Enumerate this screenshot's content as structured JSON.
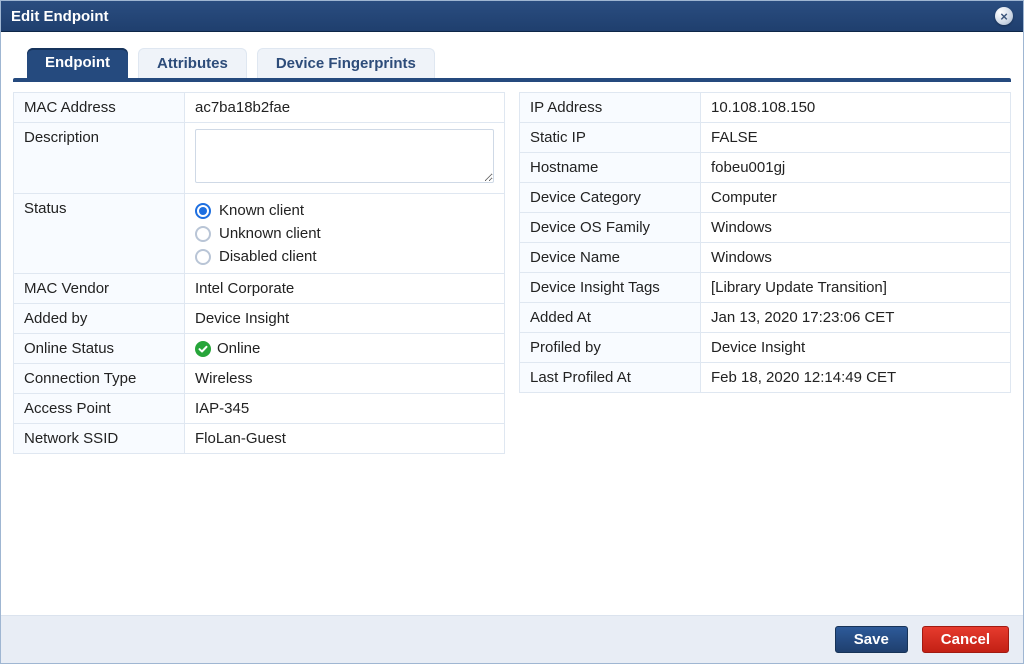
{
  "window": {
    "title": "Edit Endpoint",
    "close_icon": "×"
  },
  "tabs": [
    {
      "label": "Endpoint",
      "active": true
    },
    {
      "label": "Attributes",
      "active": false
    },
    {
      "label": "Device Fingerprints",
      "active": false
    }
  ],
  "left": {
    "mac_address": {
      "label": "MAC Address",
      "value": "ac7ba18b2fae"
    },
    "description": {
      "label": "Description",
      "value": ""
    },
    "status": {
      "label": "Status",
      "options": [
        {
          "label": "Known client",
          "checked": true
        },
        {
          "label": "Unknown client",
          "checked": false
        },
        {
          "label": "Disabled client",
          "checked": false
        }
      ]
    },
    "mac_vendor": {
      "label": "MAC Vendor",
      "value": "Intel Corporate"
    },
    "added_by": {
      "label": "Added by",
      "value": "Device Insight"
    },
    "online_status": {
      "label": "Online Status",
      "value": "Online",
      "icon": "check-circle"
    },
    "connection_type": {
      "label": "Connection Type",
      "value": "Wireless"
    },
    "access_point": {
      "label": "Access Point",
      "value": "IAP-345"
    },
    "network_ssid": {
      "label": "Network SSID",
      "value": "FloLan-Guest"
    }
  },
  "right": {
    "ip_address": {
      "label": "IP Address",
      "value": "10.108.108.150"
    },
    "static_ip": {
      "label": "Static IP",
      "value": "FALSE"
    },
    "hostname": {
      "label": "Hostname",
      "value": "fobeu001gj"
    },
    "device_category": {
      "label": "Device Category",
      "value": "Computer"
    },
    "device_os_family": {
      "label": "Device OS Family",
      "value": "Windows"
    },
    "device_name": {
      "label": "Device Name",
      "value": "Windows"
    },
    "device_insight_tags": {
      "label": "Device Insight Tags",
      "value": "[Library Update Transition]"
    },
    "added_at": {
      "label": "Added At",
      "value": "Jan 13, 2020 17:23:06 CET"
    },
    "profiled_by": {
      "label": "Profiled by",
      "value": "Device Insight"
    },
    "last_profiled_at": {
      "label": "Last Profiled At",
      "value": "Feb 18, 2020 12:14:49 CET"
    }
  },
  "footer": {
    "save": "Save",
    "cancel": "Cancel"
  }
}
